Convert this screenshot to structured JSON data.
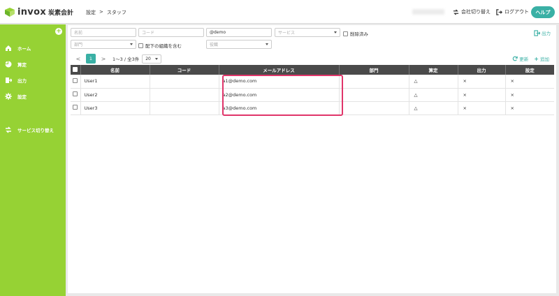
{
  "header": {
    "logo_text": "invox",
    "logo_sub": "炭素会計",
    "breadcrumb": [
      "設定",
      ">",
      "スタッフ"
    ],
    "switch_company": "会社切り替え",
    "logout": "ログアウト",
    "help": "ヘルプ"
  },
  "sidebar": {
    "items": [
      {
        "label": "ホーム",
        "icon": "home-icon"
      },
      {
        "label": "算定",
        "icon": "pie-chart-icon"
      },
      {
        "label": "出力",
        "icon": "export-icon"
      },
      {
        "label": "設定",
        "icon": "gear-icon"
      },
      {
        "label": "サービス切り替え",
        "icon": "switch-icon"
      }
    ]
  },
  "filters": {
    "name_placeholder": "名前",
    "code_placeholder": "コード",
    "email_value": "@demo",
    "service_placeholder": "サービス",
    "deleted_label": "削除済み",
    "department_placeholder": "部門",
    "include_sub_label": "配下の組織を含む",
    "role_placeholder": "役職",
    "export_label": "出力"
  },
  "pager": {
    "prev": "<",
    "current_page": "1",
    "next": ">",
    "info": "1〜3 / 全3件",
    "page_size": "20"
  },
  "toolbar": {
    "refresh": "更新",
    "add": "追加"
  },
  "table": {
    "columns": [
      "名前",
      "コード",
      "メールアドレス",
      "部門",
      "算定",
      "出力",
      "設定"
    ],
    "rows": [
      {
        "name": "User1",
        "code": "",
        "email": "a1@demo.com",
        "department": "",
        "calc": "△",
        "output": "×",
        "settings": "×"
      },
      {
        "name": "User2",
        "code": "",
        "email": "a2@demo.com",
        "department": "",
        "calc": "△",
        "output": "×",
        "settings": "×"
      },
      {
        "name": "User3",
        "code": "",
        "email": "a3@demo.com",
        "department": "",
        "calc": "△",
        "output": "×",
        "settings": "×"
      }
    ]
  },
  "colors": {
    "sidebar": "#96d234",
    "accent": "#3ab0a5",
    "table_header": "#4a4a4a",
    "highlight": "#e0356a"
  }
}
